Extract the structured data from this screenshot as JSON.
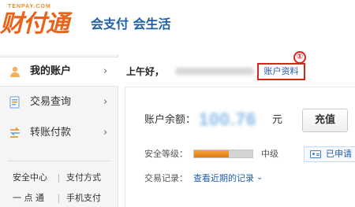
{
  "header": {
    "logo_domain": "TENPAY.COM",
    "logo_text": "财付通",
    "slogan": "会支付 会生活"
  },
  "sidebar": {
    "items": [
      {
        "label": "我的账户",
        "icon": "user-icon",
        "arrow": "›"
      },
      {
        "label": "交易查询",
        "icon": "list-icon",
        "arrow": "›"
      },
      {
        "label": "转账付款",
        "icon": "transfer-icon",
        "arrow": "›"
      }
    ],
    "links": [
      "安全中心",
      "支付方式",
      "一 点 通",
      "手机支付"
    ]
  },
  "greeting": {
    "text": "上午好，",
    "profile_link": "账户资料",
    "callout": "①"
  },
  "balance": {
    "label": "账户余额：",
    "amount": "100.76",
    "unit": "元",
    "recharge": "充值"
  },
  "security": {
    "label": "安全等级：",
    "level": "中级",
    "progress": 0.6,
    "applied": "已申请"
  },
  "records": {
    "label": "交易记录：",
    "link": "查看近期的记录",
    "chevron": "⌄"
  },
  "colors": {
    "brand_orange": "#e8641b",
    "link_blue": "#1f5fa8",
    "highlight_red": "#d9261c",
    "security_fill": "#e27a12"
  }
}
